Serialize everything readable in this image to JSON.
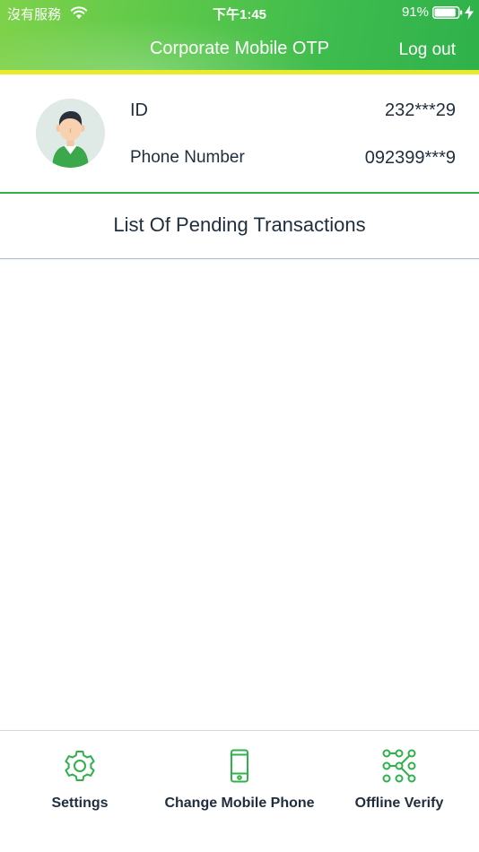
{
  "status_bar": {
    "carrier": "沒有服務",
    "time": "下午1:45",
    "battery_percent": "91%",
    "battery_level": 0.91
  },
  "header": {
    "title": "Corporate Mobile OTP",
    "logout_label": "Log out"
  },
  "profile": {
    "id_label": "ID",
    "id_value": "232***29",
    "phone_label": "Phone Number",
    "phone_value": "092399***9"
  },
  "pending": {
    "title": "List Of Pending Transactions",
    "items": []
  },
  "tab_bar": {
    "items": [
      {
        "label": "Settings",
        "icon": "gear-icon"
      },
      {
        "label": "Change Mobile Phone",
        "icon": "mobile-phone-icon"
      },
      {
        "label": "Offline Verify",
        "icon": "pattern-grid-icon"
      }
    ]
  },
  "colors": {
    "brand_green": "#2fb14b",
    "header_light_green": "#7fd24a",
    "accent_yellow": "#e8ea2a",
    "text_dark": "#1f2d3d"
  }
}
